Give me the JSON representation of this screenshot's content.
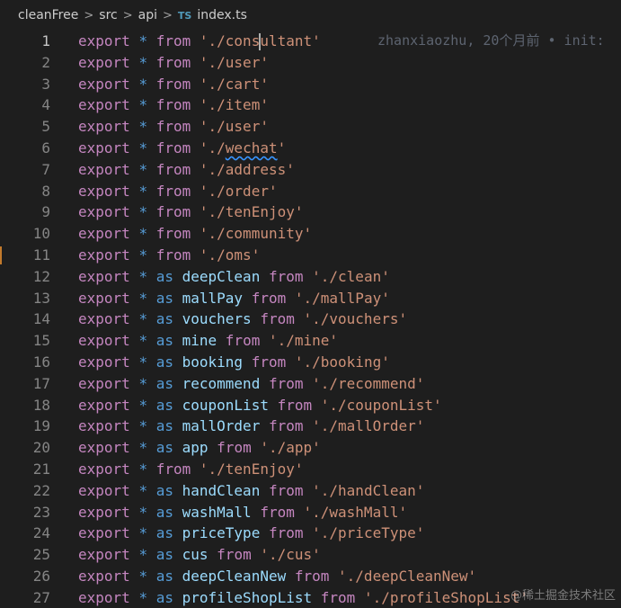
{
  "breadcrumb": {
    "items": [
      "cleanFree",
      "src",
      "api"
    ],
    "separator": ">",
    "file_icon": "TS",
    "file": "index.ts"
  },
  "blame": "zhanxiaozhu, 20个月前 • init:",
  "watermark": "@稀土掘金技术社区",
  "lines": [
    {
      "n": "1",
      "t": "from",
      "path": "'./consultant'"
    },
    {
      "n": "2",
      "t": "from",
      "path": "'./user'"
    },
    {
      "n": "3",
      "t": "from",
      "path": "'./cart'"
    },
    {
      "n": "4",
      "t": "from",
      "path": "'./item'"
    },
    {
      "n": "5",
      "t": "from",
      "path": "'./user'"
    },
    {
      "n": "6",
      "t": "from",
      "path": "'./wechat'"
    },
    {
      "n": "7",
      "t": "from",
      "path": "'./address'"
    },
    {
      "n": "8",
      "t": "from",
      "path": "'./order'"
    },
    {
      "n": "9",
      "t": "from",
      "path": "'./tenEnjoy'"
    },
    {
      "n": "10",
      "t": "from",
      "path": "'./community'"
    },
    {
      "n": "11",
      "t": "from",
      "path": "'./oms'"
    },
    {
      "n": "12",
      "t": "as",
      "name": "deepClean",
      "path": "'./clean'"
    },
    {
      "n": "13",
      "t": "as",
      "name": "mallPay",
      "path": "'./mallPay'"
    },
    {
      "n": "14",
      "t": "as",
      "name": "vouchers",
      "path": "'./vouchers'"
    },
    {
      "n": "15",
      "t": "as",
      "name": "mine",
      "path": "'./mine'"
    },
    {
      "n": "16",
      "t": "as",
      "name": "booking",
      "path": "'./booking'"
    },
    {
      "n": "17",
      "t": "as",
      "name": "recommend",
      "path": "'./recommend'"
    },
    {
      "n": "18",
      "t": "as",
      "name": "couponList",
      "path": "'./couponList'"
    },
    {
      "n": "19",
      "t": "as",
      "name": "mallOrder",
      "path": "'./mallOrder'"
    },
    {
      "n": "20",
      "t": "as",
      "name": "app",
      "path": "'./app'"
    },
    {
      "n": "21",
      "t": "from",
      "path": "'./tenEnjoy'"
    },
    {
      "n": "22",
      "t": "as",
      "name": "handClean",
      "path": "'./handClean'"
    },
    {
      "n": "23",
      "t": "as",
      "name": "washMall",
      "path": "'./washMall'"
    },
    {
      "n": "24",
      "t": "as",
      "name": "priceType",
      "path": "'./priceType'"
    },
    {
      "n": "25",
      "t": "as",
      "name": "cus",
      "path": "'./cus'"
    },
    {
      "n": "26",
      "t": "as",
      "name": "deepCleanNew",
      "path": "'./deepCleanNew'"
    },
    {
      "n": "27",
      "t": "as",
      "name": "profileShopList",
      "path": "'./profileShopList'"
    }
  ],
  "keywords": {
    "export": "export",
    "star": "*",
    "as": "as",
    "from": "from"
  },
  "colors": {
    "background": "#1e1e1e",
    "keyword": "#c586c0",
    "operator": "#569cd6",
    "identifier": "#9cdcfe",
    "string": "#ce9178",
    "line_number": "#858585",
    "ts_icon": "#519aba",
    "modified_gutter": "#c27a2c"
  }
}
